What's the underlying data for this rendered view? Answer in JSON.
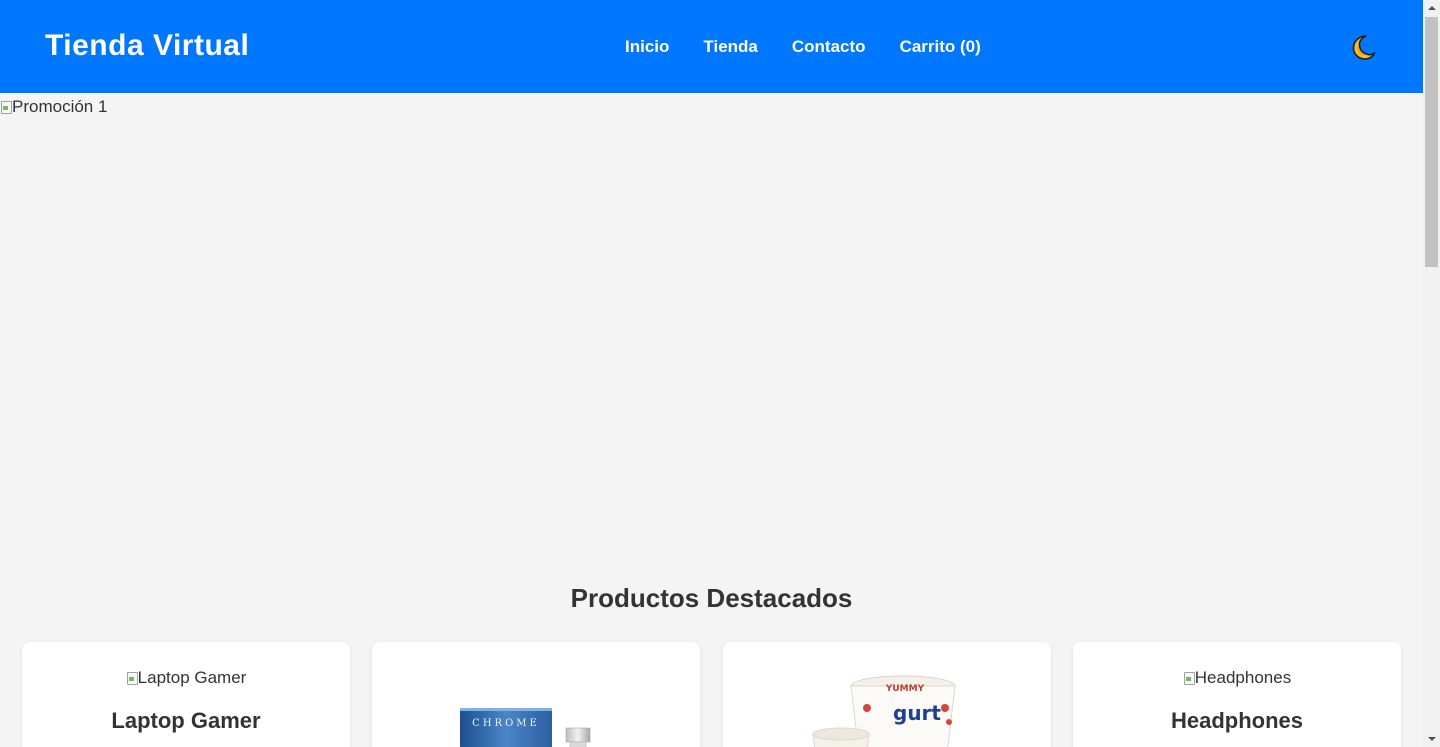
{
  "header": {
    "brand": "Tienda Virtual",
    "nav": [
      {
        "label": "Inicio"
      },
      {
        "label": "Tienda"
      },
      {
        "label": "Contacto"
      },
      {
        "label": "Carrito (0)"
      }
    ],
    "theme_icon": "moon-icon"
  },
  "promo": {
    "alt": "Promoción 1"
  },
  "featured": {
    "title": "Productos Destacados",
    "products": [
      {
        "image_alt": "Laptop Gamer",
        "name": "Laptop Gamer",
        "image_state": "broken"
      },
      {
        "image_text": "CHROME",
        "image_state": "loaded-perfume"
      },
      {
        "image_text_1": "YUMMY",
        "image_text_2": "gurt",
        "image_state": "loaded-yogurt"
      },
      {
        "image_alt": "Headphones",
        "name": "Headphones",
        "image_state": "broken"
      }
    ]
  },
  "colors": {
    "header_bg": "#0077ff",
    "page_bg": "#f4f4f4",
    "card_bg": "#ffffff",
    "text": "#333333"
  }
}
